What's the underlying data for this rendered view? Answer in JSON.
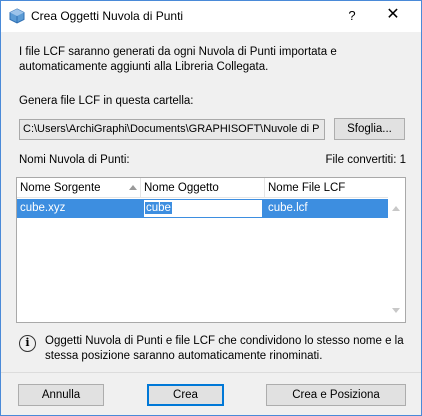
{
  "window": {
    "title": "Crea Oggetti Nuvola di Punti",
    "help_glyph": "?",
    "close_glyph": "✕",
    "icon_name": "pointcloud-app-icon"
  },
  "description": "I file LCF saranno generati da ogni Nuvola di Punti importata e automaticamente aggiunti alla Libreria Collegata.",
  "folder": {
    "label": "Genera file LCF in questa cartella:",
    "path": "C:\\Users\\ArchiGraphi\\Documents\\GRAPHISOFT\\Nuvole di P",
    "browse_label": "Sfoglia..."
  },
  "list": {
    "label": "Nomi Nuvola di Punti:",
    "converted": "File convertiti: 1",
    "columns": [
      "Nome Sorgente",
      "Nome Oggetto",
      "Nome File LCF"
    ],
    "rows": [
      {
        "source": "cube.xyz",
        "object": "cube",
        "lcf": "cube.lcf"
      }
    ]
  },
  "info": {
    "text": "Oggetti Nuvola di Punti e file LCF che condividono lo stesso nome e la stessa posizione saranno automaticamente rinominati.",
    "icon_glyph": "i"
  },
  "buttons": {
    "cancel": "Annulla",
    "create": "Crea",
    "create_place": "Crea e Posiziona"
  },
  "colors": {
    "selection": "#3d8ee0",
    "window_border": "#4a8ad8",
    "default_button_border": "#0078d7"
  }
}
